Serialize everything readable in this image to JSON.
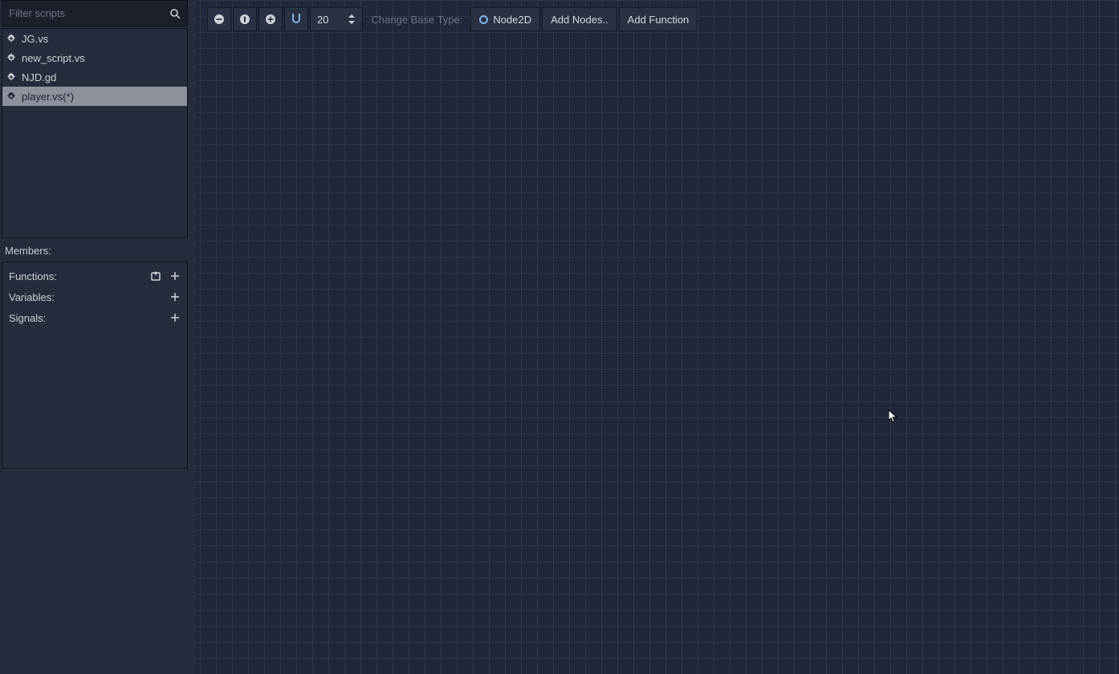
{
  "sidebar": {
    "filter_placeholder": "Filter scripts",
    "scripts": [
      {
        "name": "JG.vs",
        "selected": false
      },
      {
        "name": "new_script.vs",
        "selected": false
      },
      {
        "name": "NJD.gd",
        "selected": false
      },
      {
        "name": "player.vs(*)",
        "selected": true
      }
    ],
    "members_label": "Members:",
    "sections": {
      "functions_label": "Functions:",
      "variables_label": "Variables:",
      "signals_label": "Signals:"
    }
  },
  "toolbar": {
    "snap_value": "20",
    "change_base_label": "Change Base Type:",
    "base_type": "Node2D",
    "add_nodes_label": "Add Nodes..",
    "add_function_label": "Add Function"
  }
}
